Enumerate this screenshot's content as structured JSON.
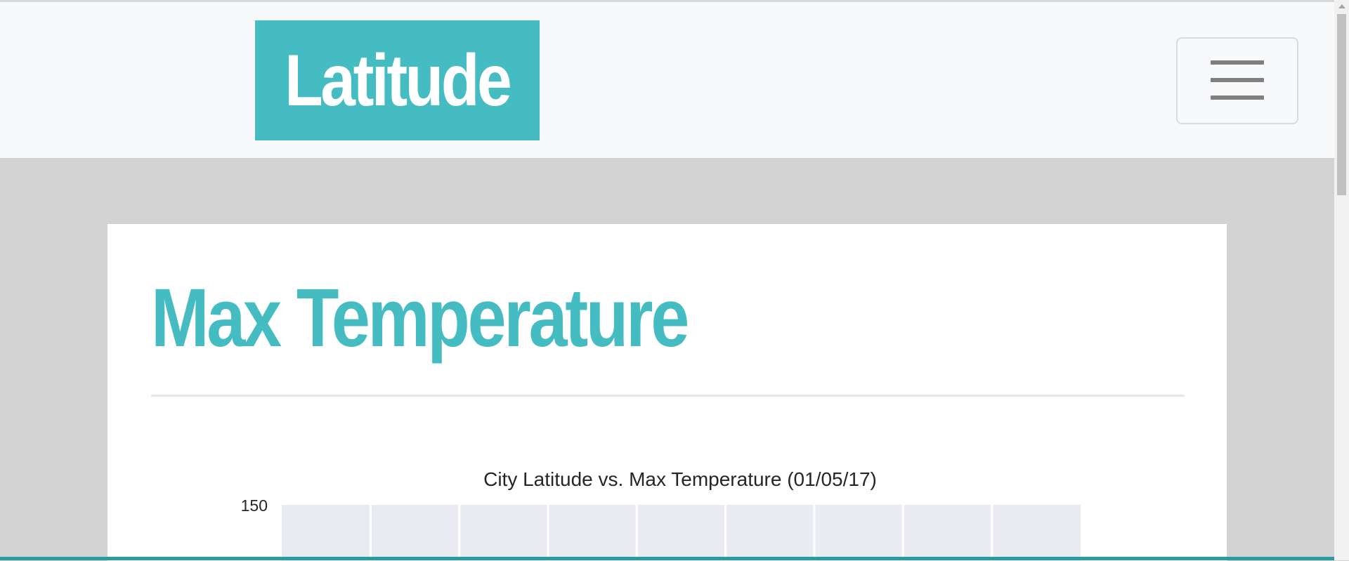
{
  "navbar": {
    "brand": "Latitude",
    "toggler_icon": "hamburger-icon"
  },
  "main": {
    "title": "Max Temperature"
  },
  "colors": {
    "accent": "#44bcc2",
    "page_background": "#d3d3d3",
    "navbar_background": "#f8f9fa",
    "plot_background": "#eaeaf2"
  },
  "chart_data": {
    "type": "scatter",
    "title": "City Latitude vs. Max Temperature (01/05/17)",
    "xlabel": "",
    "ylabel": "",
    "y_ticks_visible": [
      150
    ],
    "grid": true,
    "style": "seaborn-darkgrid",
    "vertical_gridline_count": 8
  }
}
